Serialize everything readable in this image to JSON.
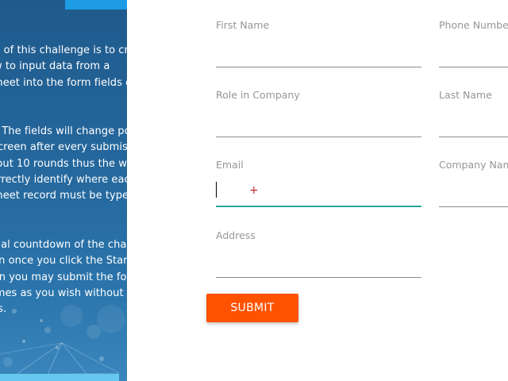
{
  "instructions": {
    "paragraph_1": "The goal of this challenge is to create a\nworkflow to input data from a\nspreadsheet into the form fields on the\nscreen.",
    "paragraph_2": "Beware! The fields will change position\non the screen after every submission\nthroughout 10 rounds thus the workflow\nmust correctly identify where each\nspreadsheet record must be typed every\ntime.",
    "paragraph_3": "The actual countdown of the challenge\nwill begin once you click the Start button\nuntil then you may submit the form as\nmany times as you wish without receiving\npenalties."
  },
  "form": {
    "fields": [
      {
        "id": "first_name",
        "label": "First Name",
        "value": ""
      },
      {
        "id": "phone_number",
        "label": "Phone Number",
        "value": ""
      },
      {
        "id": "role_in_company",
        "label": "Role in Company",
        "value": ""
      },
      {
        "id": "last_name",
        "label": "Last Name",
        "value": ""
      },
      {
        "id": "email",
        "label": "Email",
        "value": ""
      },
      {
        "id": "company_name",
        "label": "Company Name",
        "value": ""
      },
      {
        "id": "address",
        "label": "Address",
        "value": ""
      }
    ],
    "submit_label": "SUBMIT"
  },
  "colors": {
    "sidebar": "#25689d",
    "accent_tab": "#1d9be3",
    "focus_underline": "#26a69a",
    "submit": "#ff5200",
    "label": "#969696"
  },
  "icons": {
    "cursor": "crosshair-cursor-icon"
  }
}
